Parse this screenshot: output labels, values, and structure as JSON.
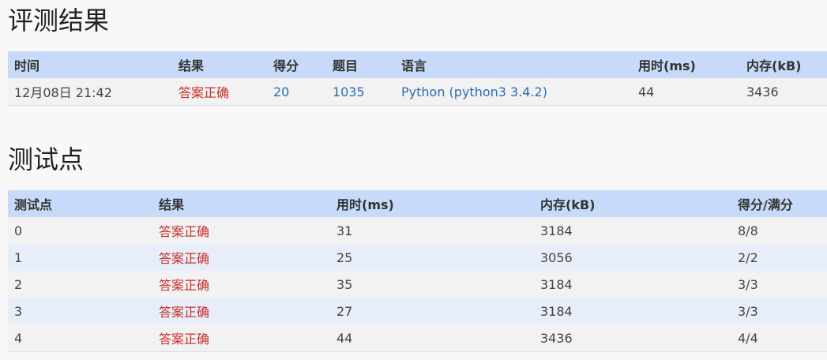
{
  "result_section": {
    "title": "评测结果",
    "headers": [
      "时间",
      "结果",
      "得分",
      "题目",
      "语言",
      "用时(ms)",
      "内存(kB)"
    ],
    "row": {
      "time": "12月08日 21:42",
      "result": "答案正确",
      "score": "20",
      "problem": "1035",
      "language": "Python (python3 3.4.2)",
      "time_ms": "44",
      "memory_kb": "3436"
    }
  },
  "cases_section": {
    "title": "测试点",
    "headers": [
      "测试点",
      "结果",
      "用时(ms)",
      "内存(kB)",
      "得分/满分"
    ],
    "rows": [
      {
        "case": "0",
        "result": "答案正确",
        "time_ms": "31",
        "memory_kb": "3184",
        "score": "8/8"
      },
      {
        "case": "1",
        "result": "答案正确",
        "time_ms": "25",
        "memory_kb": "3056",
        "score": "2/2"
      },
      {
        "case": "2",
        "result": "答案正确",
        "time_ms": "35",
        "memory_kb": "3184",
        "score": "3/3"
      },
      {
        "case": "3",
        "result": "答案正确",
        "time_ms": "27",
        "memory_kb": "3184",
        "score": "3/3"
      },
      {
        "case": "4",
        "result": "答案正确",
        "time_ms": "44",
        "memory_kb": "3436",
        "score": "4/4"
      }
    ]
  },
  "colors": {
    "header_bg": "#c7daf9",
    "accepted": "#c9302c",
    "link": "#2a6cb5"
  }
}
